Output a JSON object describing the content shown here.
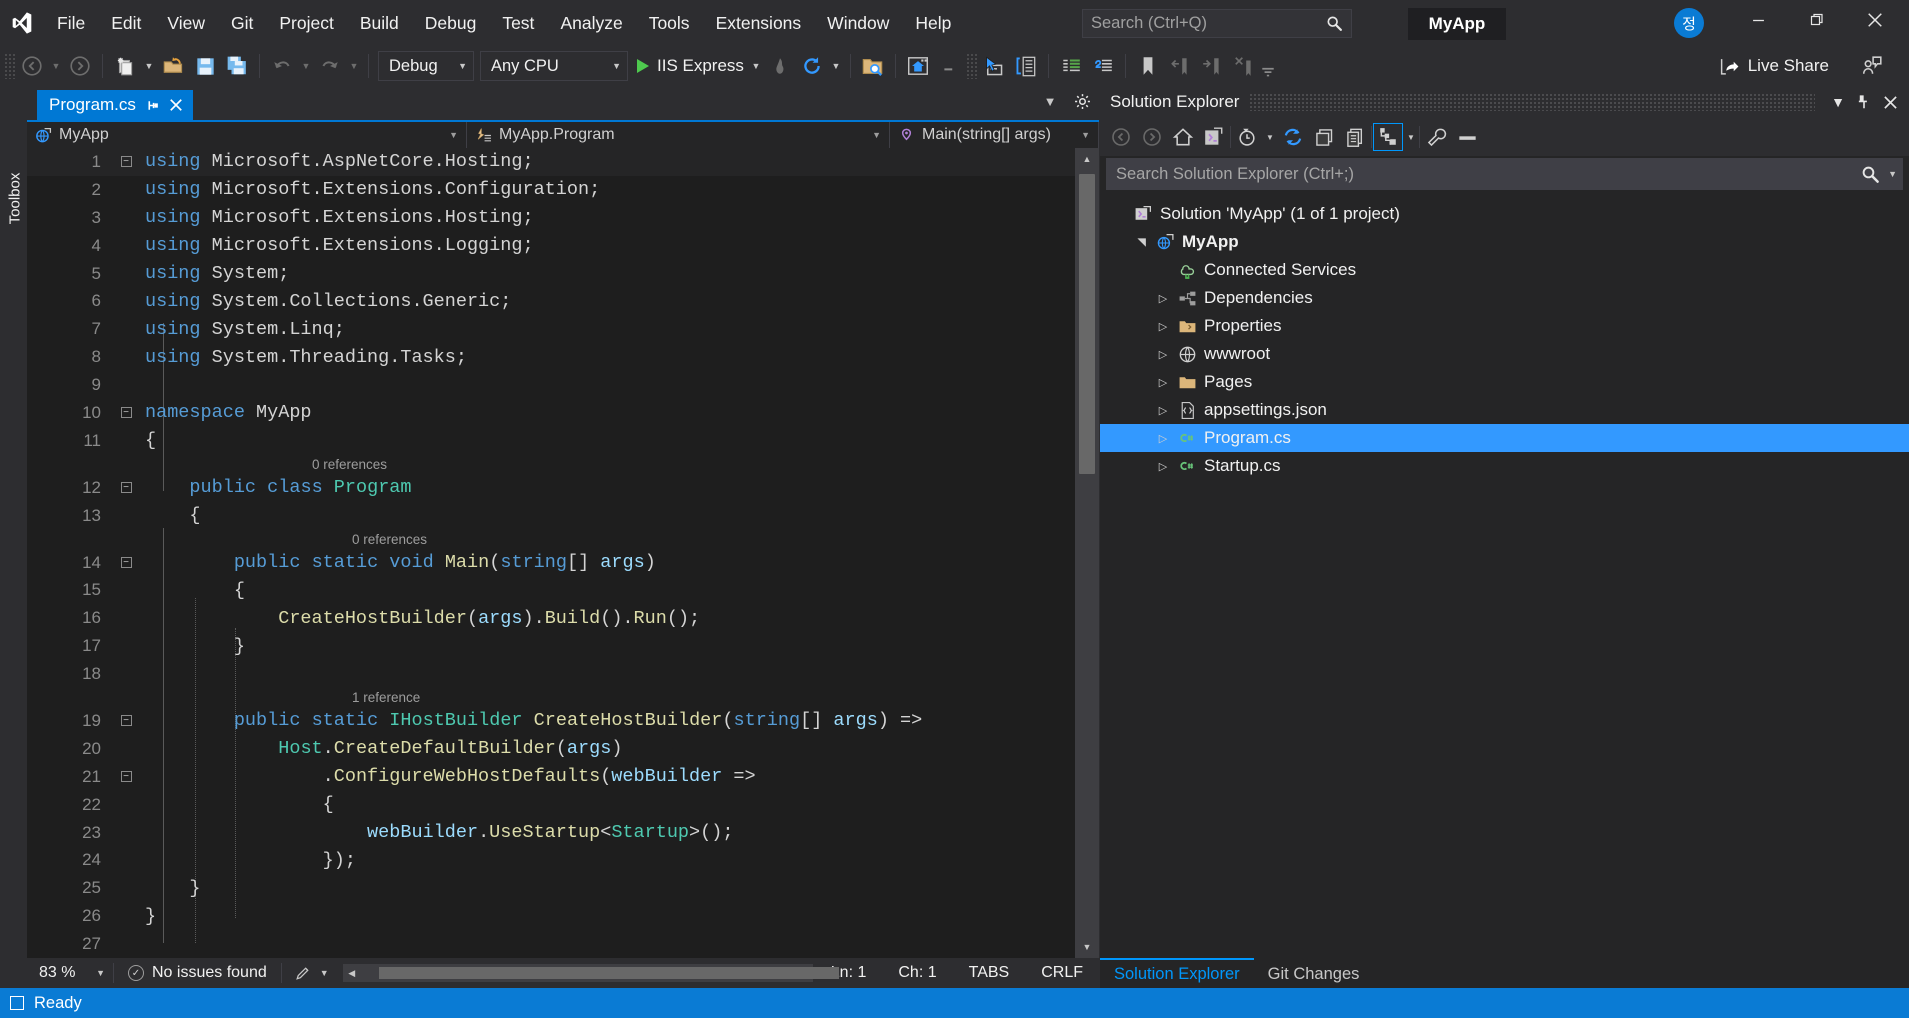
{
  "window": {
    "app_title": "MyApp",
    "avatar_initial": "정",
    "minimize": "minimize-icon",
    "maximize": "restore-icon",
    "close": "close-icon"
  },
  "menubar": {
    "logo": "visual-studio-logo",
    "items": [
      "File",
      "Edit",
      "View",
      "Git",
      "Project",
      "Build",
      "Debug",
      "Test",
      "Analyze",
      "Tools",
      "Extensions",
      "Window",
      "Help"
    ],
    "search_placeholder": "Search (Ctrl+Q)"
  },
  "toolbar": {
    "nav_back": "back-arrow-icon",
    "nav_forward": "forward-arrow-icon",
    "new_project": "new-project-icon",
    "open_file": "open-file-icon",
    "save": "save-icon",
    "save_all": "save-all-icon",
    "undo": "undo-icon",
    "redo": "redo-icon",
    "configuration": "Debug",
    "platform": "Any CPU",
    "run_label": "IIS Express",
    "hot_reload": "hot-reload-icon",
    "restart": "refresh-icon",
    "search_folder": "find-in-files-icon",
    "home": "home-icon",
    "select_element": "select-element-icon",
    "live_visual_tree": "live-visual-tree-icon",
    "comment": "comment-icon",
    "uncomment": "uncomment-icon",
    "bookmark": "bookmark-icon",
    "prev_bookmark": "previous-bookmark-icon",
    "next_bookmark": "next-bookmark-icon",
    "clear_bookmarks": "clear-bookmarks-icon",
    "overflow": "toolbar-overflow-icon",
    "live_share": "Live Share",
    "feedback": "send-feedback-icon"
  },
  "editor": {
    "tab": {
      "title": "Program.cs",
      "pin": "pin-icon",
      "close": "close-icon"
    },
    "tabstrip_icons": [
      "minimize-tab-group-icon",
      "editor-settings-icon"
    ],
    "navbar": {
      "project": "MyApp",
      "type": "MyApp.Program",
      "member": "Main(string[] args)"
    },
    "lines": [
      {
        "n": "1",
        "fold": "minus",
        "hl": true,
        "tokens": [
          {
            "t": "using",
            "c": "k"
          },
          {
            "t": " Microsoft.AspNetCore.Hosting;",
            "c": "pl"
          }
        ]
      },
      {
        "n": "2",
        "fold": "",
        "tokens": [
          {
            "t": "using",
            "c": "k"
          },
          {
            "t": " Microsoft.Extensions.Configuration;",
            "c": "pl"
          }
        ]
      },
      {
        "n": "3",
        "fold": "",
        "tokens": [
          {
            "t": "using",
            "c": "k"
          },
          {
            "t": " Microsoft.Extensions.Hosting;",
            "c": "pl"
          }
        ]
      },
      {
        "n": "4",
        "fold": "",
        "tokens": [
          {
            "t": "using",
            "c": "k"
          },
          {
            "t": " Microsoft.Extensions.Logging;",
            "c": "pl"
          }
        ]
      },
      {
        "n": "5",
        "fold": "",
        "tokens": [
          {
            "t": "using",
            "c": "k"
          },
          {
            "t": " System;",
            "c": "pl"
          }
        ]
      },
      {
        "n": "6",
        "fold": "",
        "tokens": [
          {
            "t": "using",
            "c": "k"
          },
          {
            "t": " System.Collections.Generic;",
            "c": "pl"
          }
        ]
      },
      {
        "n": "7",
        "fold": "",
        "tokens": [
          {
            "t": "using",
            "c": "k"
          },
          {
            "t": " System.Linq;",
            "c": "pl"
          }
        ]
      },
      {
        "n": "8",
        "fold": "",
        "tokens": [
          {
            "t": "using",
            "c": "k"
          },
          {
            "t": " System.Threading.Tasks;",
            "c": "pl"
          }
        ]
      },
      {
        "n": "9",
        "fold": "",
        "tokens": []
      },
      {
        "n": "10",
        "fold": "minus",
        "tokens": [
          {
            "t": "namespace",
            "c": "k"
          },
          {
            "t": " MyApp",
            "c": "pl"
          }
        ]
      },
      {
        "n": "11",
        "fold": "",
        "tokens": [
          {
            "t": "{",
            "c": "pl"
          }
        ]
      },
      {
        "n": "12",
        "fold": "minus",
        "ref": "0 references",
        "ref_indent": 175,
        "tokens": [
          {
            "t": "    ",
            "c": "pl"
          },
          {
            "t": "public",
            "c": "k"
          },
          {
            "t": " ",
            "c": "pl"
          },
          {
            "t": "class",
            "c": "k"
          },
          {
            "t": " ",
            "c": "pl"
          },
          {
            "t": "Program",
            "c": "ty"
          }
        ]
      },
      {
        "n": "13",
        "fold": "",
        "tokens": [
          {
            "t": "    {",
            "c": "pl"
          }
        ]
      },
      {
        "n": "14",
        "fold": "minus",
        "ref": "0 references",
        "ref_indent": 215,
        "tokens": [
          {
            "t": "        ",
            "c": "pl"
          },
          {
            "t": "public",
            "c": "k"
          },
          {
            "t": " ",
            "c": "pl"
          },
          {
            "t": "static",
            "c": "k"
          },
          {
            "t": " ",
            "c": "pl"
          },
          {
            "t": "void",
            "c": "k"
          },
          {
            "t": " ",
            "c": "pl"
          },
          {
            "t": "Main",
            "c": "m"
          },
          {
            "t": "(",
            "c": "pl"
          },
          {
            "t": "string",
            "c": "k"
          },
          {
            "t": "[] ",
            "c": "pl"
          },
          {
            "t": "args",
            "c": "idf"
          },
          {
            "t": ")",
            "c": "pl"
          }
        ]
      },
      {
        "n": "15",
        "fold": "",
        "tokens": [
          {
            "t": "        {",
            "c": "pl"
          }
        ]
      },
      {
        "n": "16",
        "fold": "",
        "tokens": [
          {
            "t": "            CreateHostBuilder",
            "c": "m"
          },
          {
            "t": "(",
            "c": "pl"
          },
          {
            "t": "args",
            "c": "idf"
          },
          {
            "t": ").",
            "c": "pl"
          },
          {
            "t": "Build",
            "c": "m"
          },
          {
            "t": "().",
            "c": "pl"
          },
          {
            "t": "Run",
            "c": "m"
          },
          {
            "t": "();",
            "c": "pl"
          }
        ]
      },
      {
        "n": "17",
        "fold": "",
        "tokens": [
          {
            "t": "        }",
            "c": "pl"
          }
        ]
      },
      {
        "n": "18",
        "fold": "",
        "tokens": []
      },
      {
        "n": "19",
        "fold": "minus",
        "ref": "1 reference",
        "ref_indent": 215,
        "tokens": [
          {
            "t": "        ",
            "c": "pl"
          },
          {
            "t": "public",
            "c": "k"
          },
          {
            "t": " ",
            "c": "pl"
          },
          {
            "t": "static",
            "c": "k"
          },
          {
            "t": " ",
            "c": "pl"
          },
          {
            "t": "IHostBuilder",
            "c": "ty"
          },
          {
            "t": " ",
            "c": "pl"
          },
          {
            "t": "CreateHostBuilder",
            "c": "m"
          },
          {
            "t": "(",
            "c": "pl"
          },
          {
            "t": "string",
            "c": "k"
          },
          {
            "t": "[] ",
            "c": "pl"
          },
          {
            "t": "args",
            "c": "idf"
          },
          {
            "t": ") =>",
            "c": "pl"
          }
        ]
      },
      {
        "n": "20",
        "fold": "",
        "tokens": [
          {
            "t": "            ",
            "c": "pl"
          },
          {
            "t": "Host",
            "c": "ty"
          },
          {
            "t": ".",
            "c": "pl"
          },
          {
            "t": "CreateDefaultBuilder",
            "c": "m"
          },
          {
            "t": "(",
            "c": "pl"
          },
          {
            "t": "args",
            "c": "idf"
          },
          {
            "t": ")",
            "c": "pl"
          }
        ]
      },
      {
        "n": "21",
        "fold": "minus",
        "tokens": [
          {
            "t": "                .",
            "c": "pl"
          },
          {
            "t": "ConfigureWebHostDefaults",
            "c": "m"
          },
          {
            "t": "(",
            "c": "pl"
          },
          {
            "t": "webBuilder",
            "c": "idf"
          },
          {
            "t": " =>",
            "c": "pl"
          }
        ]
      },
      {
        "n": "22",
        "fold": "",
        "tokens": [
          {
            "t": "                {",
            "c": "pl"
          }
        ]
      },
      {
        "n": "23",
        "fold": "",
        "tokens": [
          {
            "t": "                    webBuilder",
            "c": "idf"
          },
          {
            "t": ".",
            "c": "pl"
          },
          {
            "t": "UseStartup",
            "c": "m"
          },
          {
            "t": "<",
            "c": "pl"
          },
          {
            "t": "Startup",
            "c": "ty"
          },
          {
            "t": ">();",
            "c": "pl"
          }
        ]
      },
      {
        "n": "24",
        "fold": "",
        "tokens": [
          {
            "t": "                });",
            "c": "pl"
          }
        ]
      },
      {
        "n": "25",
        "fold": "",
        "tokens": [
          {
            "t": "    }",
            "c": "pl"
          }
        ]
      },
      {
        "n": "26",
        "fold": "",
        "tokens": [
          {
            "t": "}",
            "c": "pl"
          }
        ]
      },
      {
        "n": "27",
        "fold": "",
        "tokens": []
      }
    ],
    "status": {
      "zoom": "83 %",
      "issues": "No issues found",
      "pen": "code-annotation-icon",
      "line": "Ln: 1",
      "col": "Ch: 1",
      "tabs": "TABS",
      "eol": "CRLF"
    }
  },
  "toolbox": {
    "label": "Toolbox"
  },
  "solution_explorer": {
    "title": "Solution Explorer",
    "header_icons": [
      "chevron-down-icon",
      "pin-icon",
      "close-icon"
    ],
    "toolbar_icons": [
      "back-arrow-icon",
      "forward-arrow-icon",
      "home-icon",
      "solution-icon",
      "pending-changes-icon",
      "refresh-icon",
      "collapse-all-icon",
      "show-all-files-icon",
      "view-code-icon",
      "properties-wrench-icon",
      "properties-icon"
    ],
    "search_placeholder": "Search Solution Explorer (Ctrl+;)",
    "tree": [
      {
        "label": "Solution 'MyApp' (1 of 1 project)",
        "indent": 0,
        "expander": "",
        "icon": "solution-icon",
        "bold": false,
        "selected": false
      },
      {
        "label": "MyApp",
        "indent": 1,
        "expander": "expanded",
        "icon": "web-project-icon",
        "bold": true,
        "selected": false
      },
      {
        "label": "Connected Services",
        "indent": 2,
        "expander": "",
        "icon": "connected-services-icon",
        "bold": false,
        "selected": false
      },
      {
        "label": "Dependencies",
        "indent": 2,
        "expander": "collapsed",
        "icon": "dependencies-icon",
        "bold": false,
        "selected": false
      },
      {
        "label": "Properties",
        "indent": 2,
        "expander": "collapsed",
        "icon": "properties-folder-icon",
        "bold": false,
        "selected": false
      },
      {
        "label": "wwwroot",
        "indent": 2,
        "expander": "collapsed",
        "icon": "wwwroot-icon",
        "bold": false,
        "selected": false
      },
      {
        "label": "Pages",
        "indent": 2,
        "expander": "collapsed",
        "icon": "folder-icon",
        "bold": false,
        "selected": false
      },
      {
        "label": "appsettings.json",
        "indent": 2,
        "expander": "collapsed",
        "icon": "json-file-icon",
        "bold": false,
        "selected": false
      },
      {
        "label": "Program.cs",
        "indent": 2,
        "expander": "collapsed",
        "icon": "csharp-file-icon",
        "bold": false,
        "selected": true
      },
      {
        "label": "Startup.cs",
        "indent": 2,
        "expander": "collapsed",
        "icon": "csharp-file-icon",
        "bold": false,
        "selected": false
      }
    ],
    "tabs": [
      {
        "label": "Solution Explorer",
        "active": true
      },
      {
        "label": "Git Changes",
        "active": false
      }
    ]
  },
  "statusbar": {
    "text": "Ready",
    "icon": "ready-icon"
  },
  "colors": {
    "accent": "#0078d4",
    "status_bar": "#0a7bd4",
    "selection": "#3399ff",
    "editor_bg": "#1e1e1e",
    "chrome_bg": "#2d2d30",
    "panel_bg": "#252526"
  }
}
